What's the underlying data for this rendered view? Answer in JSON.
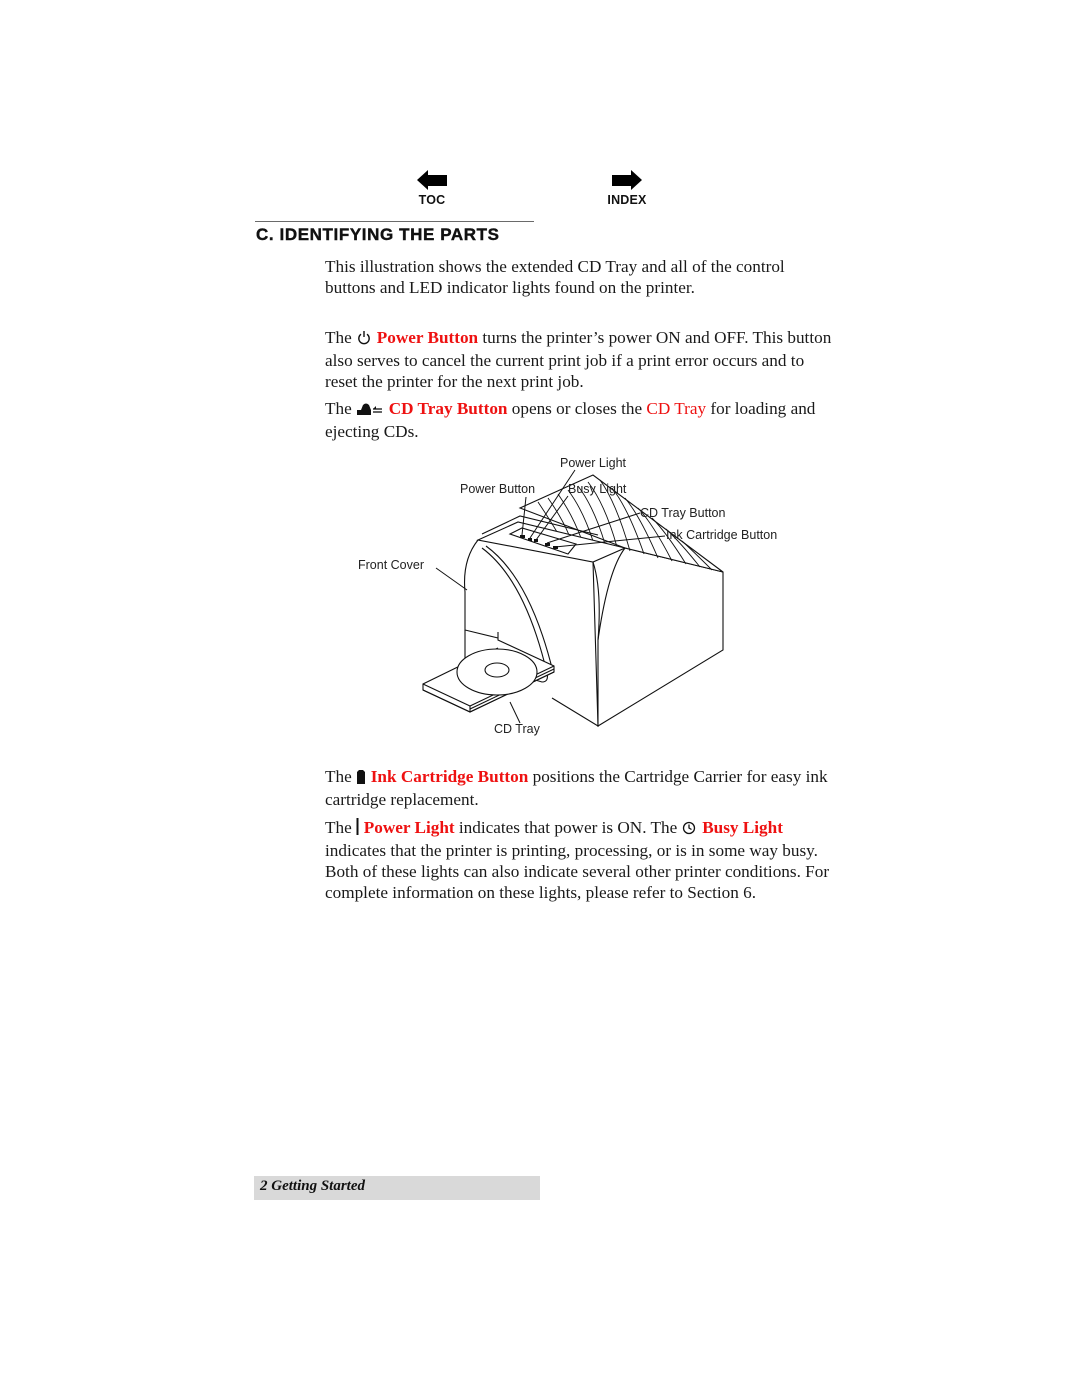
{
  "nav": {
    "toc": {
      "label": "TOC",
      "icon": "arrow-left-icon"
    },
    "index": {
      "label": "INDEX",
      "icon": "arrow-right-icon"
    }
  },
  "section": {
    "heading": "C. IDENTIFYING THE PARTS"
  },
  "paragraphs": {
    "intro": "This illustration shows the extended CD Tray and all of the control buttons and LED indicator lights found on the printer.",
    "power_button": {
      "prefix": "The",
      "icon": "power-icon",
      "term": "Power Button",
      "text": " turns the printer’s power ON and OFF. This button also serves to cancel the current print job if a print error occurs and to reset the printer for the next print job."
    },
    "cd_tray_button": {
      "prefix": "The",
      "icon": "cd-tray-eject-icon",
      "term": "CD Tray Button",
      "text_before_link": " opens or closes the ",
      "link": "CD Tray",
      "text_after_link": " for loading and ejecting CDs."
    },
    "ink_cartridge_button": {
      "prefix": "The",
      "icon": "ink-cartridge-icon",
      "term": "Ink Cartridge Button",
      "text": " positions the Cartridge Carrier for easy ink cartridge replacement."
    },
    "lights": {
      "prefix": "The",
      "power_light_icon": "power-light-icon",
      "power_light_term": "Power Light",
      "text_mid": " indicates that power is ON. The",
      "busy_light_icon": "busy-light-icon",
      "busy_light_term": "Busy Light",
      "text_end": " indicates that the printer is printing, processing, or is in some way busy. Both of these lights can also indicate several other printer conditions. For complete information on these lights, please refer to Section 6."
    }
  },
  "figure": {
    "callouts": {
      "power_light": "Power Light",
      "power_button": "Power Button",
      "busy_light": "Busy Light",
      "cd_tray_button": "CD Tray Button",
      "ink_cartridge_button": "Ink Cartridge Button",
      "front_cover": "Front Cover",
      "cd_tray": "CD Tray"
    }
  },
  "footer": {
    "page_label": "2 Getting Started"
  },
  "colors": {
    "accent_red": "#ee1111",
    "footer_bg": "#d9d9d9",
    "text": "#1a1a1a"
  }
}
